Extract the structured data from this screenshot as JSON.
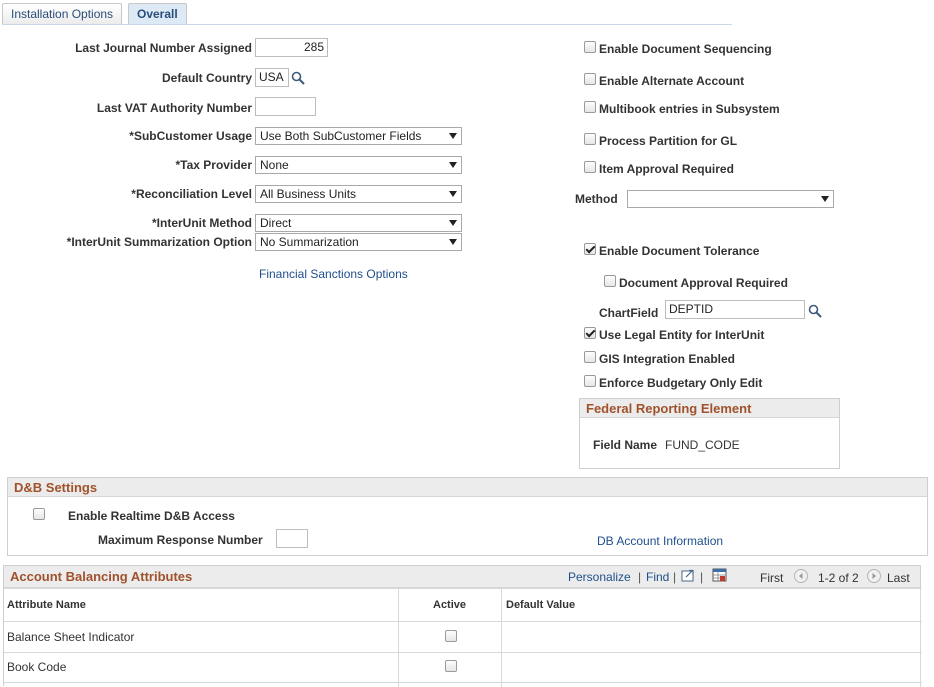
{
  "tabs": [
    {
      "label": "Installation Options",
      "active": false
    },
    {
      "label": "Overall",
      "active": true
    }
  ],
  "left_form": {
    "last_journal_label": "Last Journal Number Assigned",
    "last_journal_value": "285",
    "default_country_label": "Default Country",
    "default_country_value": "USA",
    "last_vat_label": "Last VAT Authority Number",
    "last_vat_value": "",
    "subcustomer_label": "*SubCustomer Usage",
    "subcustomer_value": "Use Both SubCustomer Fields",
    "tax_provider_label": "*Tax Provider",
    "tax_provider_value": "None",
    "reconciliation_label": "*Reconciliation Level",
    "reconciliation_value": "All Business Units",
    "interunit_method_label": "*InterUnit Method",
    "interunit_method_value": "Direct",
    "interunit_summ_label": "*InterUnit Summarization Option",
    "interunit_summ_value": "No Summarization",
    "financial_sanctions_link": "Financial Sanctions Options"
  },
  "right_form": {
    "enable_doc_seq": {
      "label": "Enable Document Sequencing",
      "checked": false
    },
    "enable_alt_account": {
      "label": "Enable Alternate Account",
      "checked": false
    },
    "multibook": {
      "label": "Multibook entries in Subsystem",
      "checked": false
    },
    "process_partition": {
      "label": "Process Partition for GL",
      "checked": false
    },
    "item_approval": {
      "label": "Item Approval Required",
      "checked": false
    },
    "method_label": "Method",
    "method_value": "",
    "enable_doc_tolerance": {
      "label": "Enable Document Tolerance",
      "checked": true
    },
    "doc_approval": {
      "label": "Document Approval Required",
      "checked": false
    },
    "chartfield_label": "ChartField",
    "chartfield_value": "DEPTID",
    "use_legal_entity": {
      "label": "Use Legal Entity for InterUnit",
      "checked": true
    },
    "gis_integration": {
      "label": "GIS Integration Enabled",
      "checked": false
    },
    "enforce_budgetary": {
      "label": "Enforce Budgetary Only Edit",
      "checked": false
    }
  },
  "federal_reporting": {
    "title": "Federal Reporting Element",
    "field_name_label": "Field Name",
    "field_name_value": "FUND_CODE"
  },
  "dnb_settings": {
    "title": "D&B Settings",
    "realtime_label": "Enable Realtime D&B Access",
    "realtime_checked": false,
    "max_response_label": "Maximum Response Number",
    "max_response_value": "",
    "db_account_link": "DB Account Information"
  },
  "account_balancing": {
    "title": "Account Balancing Attributes",
    "personalize": "Personalize",
    "find": "Find",
    "first": "First",
    "range": "1-2 of 2",
    "last": "Last",
    "columns": [
      "Attribute Name",
      "Active",
      "Default Value"
    ],
    "rows": [
      {
        "name": "Balance Sheet Indicator",
        "active": false,
        "default": ""
      },
      {
        "name": "Book Code",
        "active": false,
        "default": ""
      }
    ]
  },
  "colors": {
    "link": "#1f4f8c",
    "group_title": "#a0522d",
    "tab_active_bg": "#dde9f5"
  }
}
